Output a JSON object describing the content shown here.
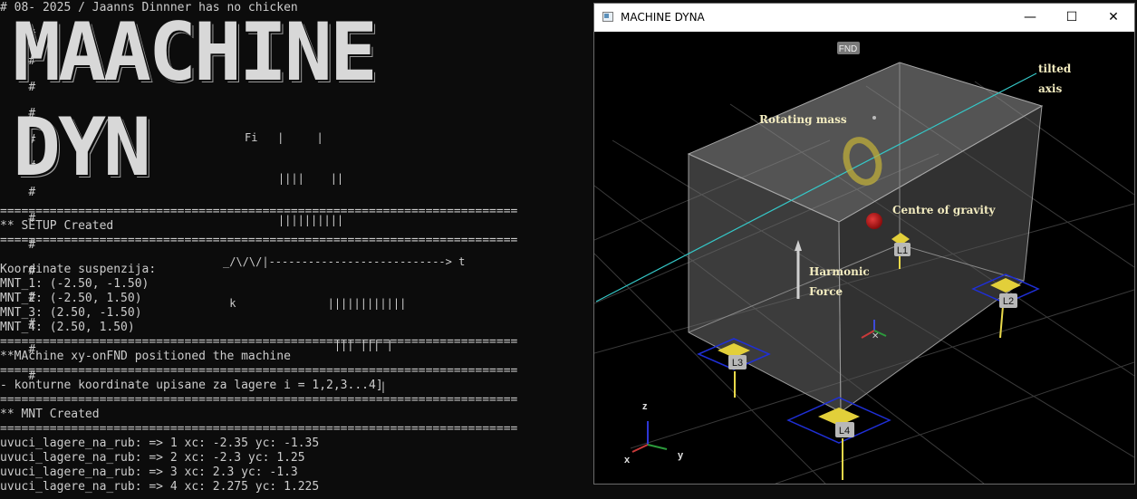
{
  "console": {
    "header": "# 08- 2025 / Jaanns Dinnner has no chicken",
    "banner_word_1": "MAACHINE",
    "banner_word_2": "DYN",
    "hash": "#",
    "ascii_art": [
      "Fi   |     |",
      "    ||||    ||",
      "    ||||||||||",
      "_/\\/\\/|---------------------------> t",
      " k              ||||||||||||",
      "                 ||| ||| |",
      "                        |"
    ],
    "separator": "=========================================================================",
    "lines": [
      "** SETUP Created",
      "Koordinate suspenzija:",
      "MNT_1: (-2.50, -1.50)",
      "MNT_2: (-2.50, 1.50)",
      "MNT_3: (2.50, -1.50)",
      "MNT_4: (2.50, 1.50)",
      "**MAchine xy-onFND positioned the machine",
      "- konturne koordinate upisane za lagere i = 1,2,3...4]",
      "** MNT Created",
      "uvuci_lagere_na_rub: => 1 xc: -2.35 yc: -1.35",
      "uvuci_lagere_na_rub: => 2 xc: -2.3 yc: 1.25",
      "uvuci_lagere_na_rub: => 3 xc: 2.3 yc: -1.3",
      "uvuci_lagere_na_rub: => 4 xc: 2.275 yc: 1.225"
    ]
  },
  "window": {
    "title": "MACHINE DYNA",
    "minimize_glyph": "—",
    "maximize_glyph": "☐",
    "close_glyph": "✕"
  },
  "scene": {
    "fnd_label": "FND",
    "tilted_axis_line1": "tilted",
    "tilted_axis_line2": "axis",
    "rotating_mass": "Rotating mass",
    "centre_of_gravity": "Centre of gravity",
    "harmonic_line1": "Harmonic",
    "harmonic_line2": "Force",
    "mounts": [
      "L1",
      "L2",
      "L3",
      "L4"
    ],
    "axis_x": "x",
    "axis_y": "y",
    "axis_z": "z",
    "colors": {
      "label_text": "#f3ecc0",
      "mount_yellow": "#e2cf3a",
      "mount_frame": "#1f2fd6",
      "axis_line": "#35c8c8",
      "cog": "#c81414",
      "grid": "#333333"
    }
  }
}
